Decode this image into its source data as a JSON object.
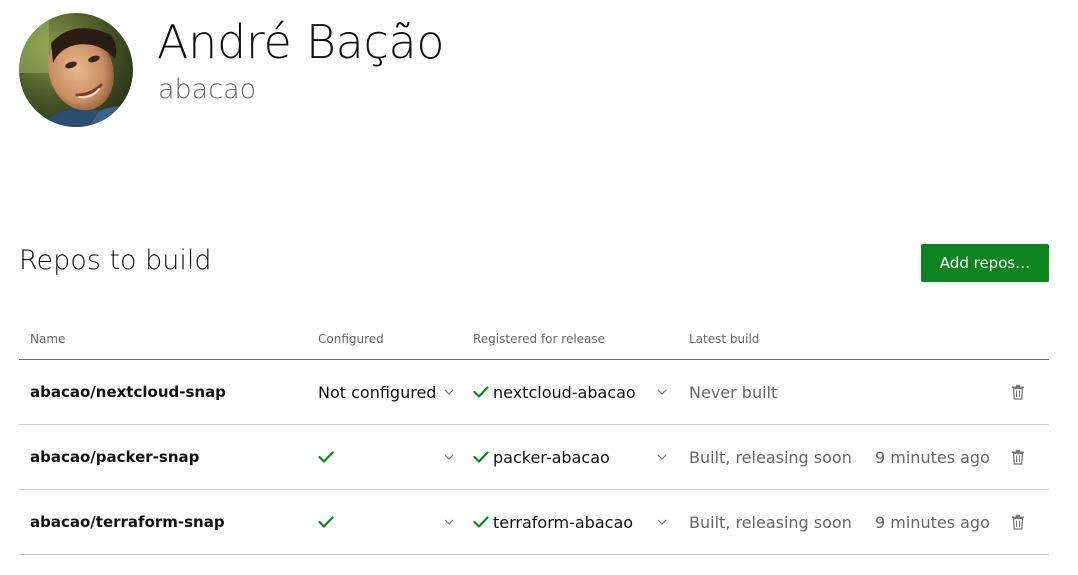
{
  "profile": {
    "name": "André Bação",
    "username": "abacao"
  },
  "section": {
    "title": "Repos to build",
    "add_button_label": "Add repos…"
  },
  "table": {
    "headers": {
      "name": "Name",
      "configured": "Configured",
      "registered": "Registered for release",
      "latest_build": "Latest build"
    },
    "rows": [
      {
        "repo": "abacao/nextcloud-snap",
        "configured": "Not configured",
        "registered": "nextcloud-abacao",
        "build_status": "Never built",
        "build_time": ""
      },
      {
        "repo": "abacao/packer-snap",
        "configured": "",
        "registered": "packer-abacao",
        "build_status": "Built, releasing soon",
        "build_time": "9 minutes ago"
      },
      {
        "repo": "abacao/terraform-snap",
        "configured": "",
        "registered": "terraform-abacao",
        "build_status": "Built, releasing soon",
        "build_time": "9 minutes ago"
      }
    ]
  },
  "colors": {
    "accent_green": "#0e8420",
    "check_green": "#0e8420",
    "muted_text": "#666666"
  },
  "icons": {
    "check": "check-icon",
    "chevron": "chevron-down-icon",
    "trash": "trash-icon"
  }
}
